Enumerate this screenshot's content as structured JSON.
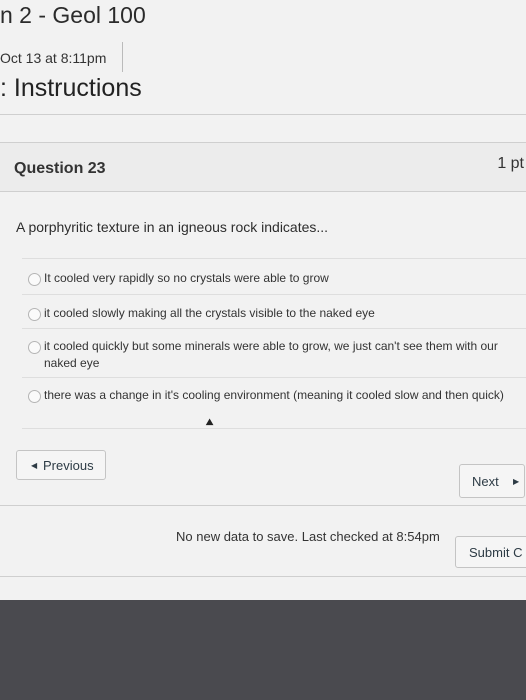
{
  "header": {
    "title": "n 2 - Geol 100",
    "date": "Oct 13 at 8:11pm",
    "instructions": ": Instructions"
  },
  "question": {
    "title": "Question 23",
    "points": "1 pt",
    "text": "A porphyritic texture in an igneous rock indicates...",
    "options": [
      {
        "label": "It cooled very rapidly so no crystals were able to grow"
      },
      {
        "label": "it cooled slowly making all the crystals visible to the naked eye"
      },
      {
        "label": "it cooled quickly but some minerals were able to grow, we just can't see them with our",
        "label2": "naked eye"
      },
      {
        "label": "there was a change in it's cooling environment (meaning it cooled slow and then quick)"
      }
    ]
  },
  "nav": {
    "previous": "Previous",
    "next": "Next"
  },
  "footer": {
    "status": "No new data to save. Last checked at 8:54pm",
    "submit": "Submit C"
  }
}
